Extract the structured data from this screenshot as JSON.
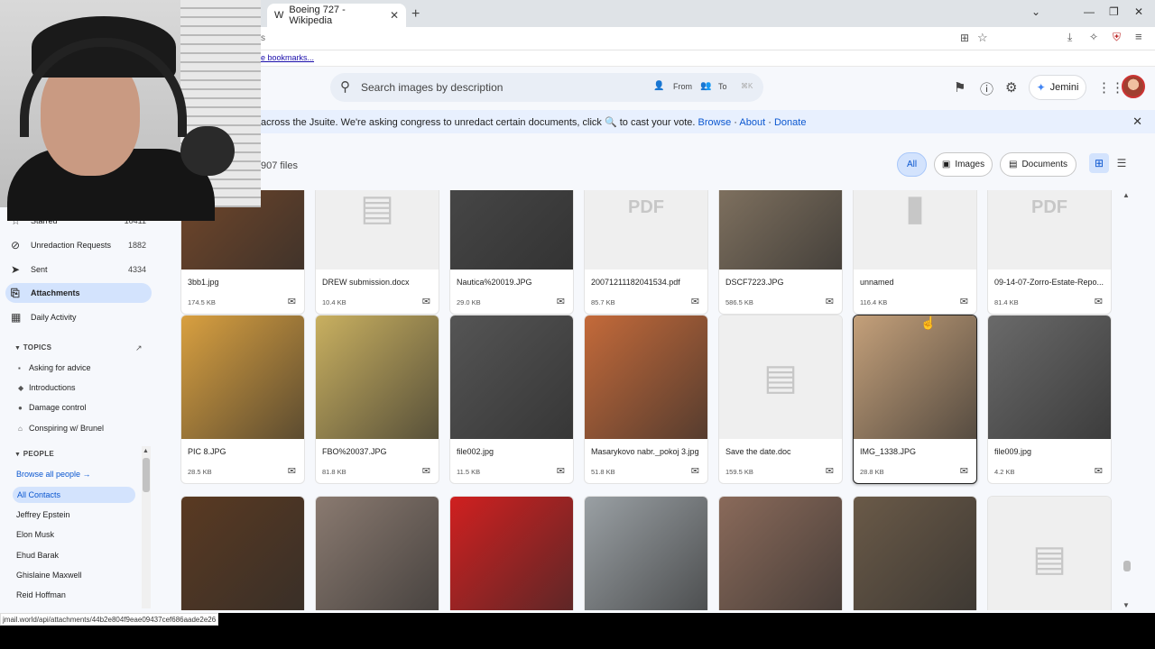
{
  "browser": {
    "tab_title": "Boeing 727 - Wikipedia",
    "tab_favicon": "W",
    "bookmarks_text": "e bookmarks...",
    "address_partial": "s"
  },
  "header": {
    "search_placeholder": "Search images by description",
    "from_label": "From",
    "to_label": "To",
    "shortcut": "⌘K",
    "jemini_label": "Jemini"
  },
  "banner": {
    "text": "across the Jsuite. We're asking congress to unredact certain documents, click 🔍 to cast your vote.",
    "browse": "Browse",
    "about": "About",
    "donate": "Donate",
    "sep": "·"
  },
  "toolbar": {
    "file_count": "907 files",
    "filters": [
      "All",
      "Images",
      "Documents"
    ]
  },
  "sidebar": {
    "nav": [
      {
        "label": "Starred",
        "count": "10411",
        "icon": "star-icon"
      },
      {
        "label": "Unredaction Requests",
        "count": "1882",
        "icon": "eye-off-icon"
      },
      {
        "label": "Sent",
        "count": "4334",
        "icon": "send-icon"
      },
      {
        "label": "Attachments",
        "count": "",
        "icon": "paperclip-icon"
      },
      {
        "label": "Daily Activity",
        "count": "",
        "icon": "calendar-icon"
      }
    ],
    "topics_label": "TOPICS",
    "topics": [
      "Asking for advice",
      "Introductions",
      "Damage control",
      "Conspiring w/ Brunel"
    ],
    "people_label": "PEOPLE",
    "browse_people": "Browse all people →",
    "all_contacts": "All Contacts",
    "people": [
      "Jeffrey Epstein",
      "Elon Musk",
      "Ehud Barak",
      "Ghislaine Maxwell",
      "Reid Hoffman"
    ]
  },
  "files": [
    {
      "name": "3bb1.jpg",
      "size": "174.5 KB",
      "kind": "photo",
      "color": "#7a4a2a"
    },
    {
      "name": "DREW submission.docx",
      "size": "10.4 KB",
      "kind": "doc",
      "color": "#efefef"
    },
    {
      "name": "Nautica%20019.JPG",
      "size": "29.0 KB",
      "kind": "photo",
      "color": "#4a4a4a"
    },
    {
      "name": "20071211182041534.pdf",
      "size": "85.7 KB",
      "kind": "pdf",
      "color": "#efefef"
    },
    {
      "name": "DSCF7223.JPG",
      "size": "586.5 KB",
      "kind": "photo",
      "color": "#8a7a66"
    },
    {
      "name": "unnamed",
      "size": "116.4 KB",
      "kind": "blank",
      "color": "#efefef"
    },
    {
      "name": "09-14-07-Zorro-Estate-Repo...",
      "size": "81.4 KB",
      "kind": "pdf",
      "color": "#efefef"
    },
    {
      "name": "PIC 8.JPG",
      "size": "28.5 KB",
      "kind": "photo",
      "color": "#d9a040"
    },
    {
      "name": "FBO%20037.JPG",
      "size": "81.8 KB",
      "kind": "photo",
      "color": "#c9b060"
    },
    {
      "name": "file002.jpg",
      "size": "11.5 KB",
      "kind": "photo",
      "color": "#555555"
    },
    {
      "name": "Masarykovo nabr._pokoj 3.jpg",
      "size": "51.8 KB",
      "kind": "photo",
      "color": "#c46a3a"
    },
    {
      "name": "Save the date.doc",
      "size": "159.5 KB",
      "kind": "doc",
      "color": "#efefef"
    },
    {
      "name": "IMG_1338.JPG",
      "size": "28.8 KB",
      "kind": "photo",
      "color": "#c4a07a"
    },
    {
      "name": "file009.jpg",
      "size": "4.2 KB",
      "kind": "photo",
      "color": "#6a6a6a"
    },
    {
      "name": "",
      "size": "",
      "kind": "photo",
      "color": "#5a3a22"
    },
    {
      "name": "",
      "size": "",
      "kind": "photo",
      "color": "#8a7a70"
    },
    {
      "name": "",
      "size": "",
      "kind": "photo",
      "color": "#d02020"
    },
    {
      "name": "",
      "size": "",
      "kind": "photo",
      "color": "#9aa0a4"
    },
    {
      "name": "",
      "size": "",
      "kind": "photo",
      "color": "#8a6a5a"
    },
    {
      "name": "",
      "size": "",
      "kind": "photo",
      "color": "#6a5a48"
    },
    {
      "name": "",
      "size": "",
      "kind": "doc",
      "color": "#efefef"
    }
  ],
  "status_url": "jmail.world/api/attachments/44b2e804f9eae09437cef686aade2e26",
  "colors": {
    "accent": "#0b57d0",
    "active_bg": "#d3e3fd",
    "banner_bg": "#e8f0fe"
  }
}
